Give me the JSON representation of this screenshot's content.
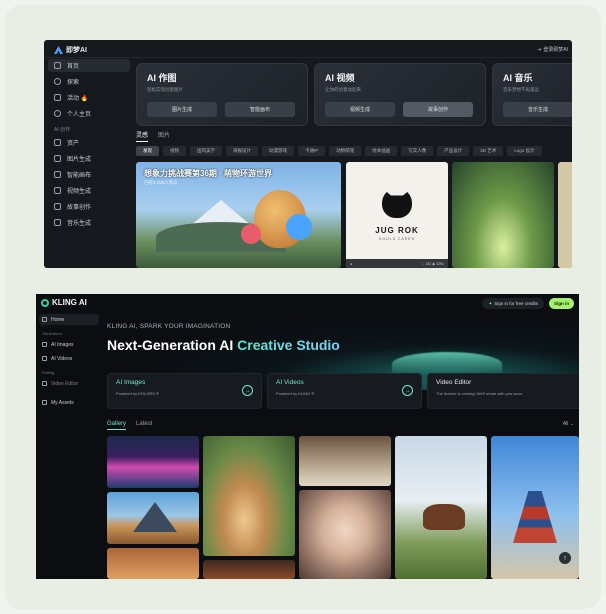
{
  "jimeng": {
    "app_name": "即梦AI",
    "login_label": "登录即梦AI",
    "sidebar": {
      "items": [
        {
          "label": "首页",
          "icon": "home-icon"
        },
        {
          "label": "探索",
          "icon": "compass-icon"
        },
        {
          "label": "活动 🔥",
          "icon": "activity-icon"
        },
        {
          "label": "个人主页",
          "icon": "user-icon"
        }
      ],
      "group_label": "AI 创作",
      "tools": [
        {
          "label": "资产",
          "icon": "folder-icon"
        },
        {
          "label": "图片生成",
          "icon": "image-icon"
        },
        {
          "label": "智能画布",
          "icon": "canvas-icon"
        },
        {
          "label": "视频生成",
          "icon": "video-icon"
        },
        {
          "label": "故事创作",
          "icon": "book-icon"
        },
        {
          "label": "音乐生成",
          "icon": "music-icon"
        }
      ]
    },
    "features": [
      {
        "title": "AI 作图",
        "subtitle": "轻松实现创意图片",
        "buttons": [
          "图片生成",
          "智能画布"
        ]
      },
      {
        "title": "AI 视频",
        "subtitle": "让你的创意动起来",
        "buttons": [
          "视频生成",
          "故事创作"
        ]
      },
      {
        "title": "AI 音乐",
        "subtitle": "音乐梦想不再遥远",
        "buttons": [
          "音乐生成"
        ]
      }
    ],
    "tabs": [
      "灵感",
      "图片"
    ],
    "chips": [
      "发现",
      "视频",
      "国风美学",
      "海报设计",
      "动漫游戏",
      "卡通IP",
      "动物萌宠",
      "绘本插画",
      "写实人像",
      "产品设计",
      "3D 艺术",
      "Logo 设计"
    ],
    "banner": {
      "title": "想象力挑战赛第36期 · 萌物环游世界",
      "subtitle": "已有2,156人参与"
    },
    "jug_card": {
      "title": "JUG ROK",
      "subtitle": "SOULS CARES",
      "likes": "153",
      "views": "3291"
    }
  },
  "kling": {
    "app_name": "KLING AI",
    "free_credits": "Sign in for free credits",
    "sign_in": "Sign in",
    "sidebar": {
      "home": "Home",
      "generation_label": "Generation",
      "images": "AI Images",
      "videos": "AI Videos",
      "editing_label": "Editing",
      "video_editor": "Video Editor",
      "assets": "My Assets"
    },
    "tagline": "KLING AI, SPARK YOUR IMAGINATION",
    "headline_main": "Next-Generation AI ",
    "headline_accent": "Creative Studio",
    "cards": [
      {
        "title": "AI Images",
        "subtitle": "Powered by KOLORS ®"
      },
      {
        "title": "AI Videos",
        "subtitle": "Powered by KLING ®"
      },
      {
        "title": "Video Editor",
        "subtitle": "The feature is coming! We'll share with you soon."
      }
    ],
    "tabs": [
      "Gallery",
      "Latest"
    ],
    "filter": "All"
  },
  "colors": {
    "kling_accent": "#6ee7d2",
    "kling_signin": "#a7f06b",
    "jimeng_bg": "#15181d"
  }
}
